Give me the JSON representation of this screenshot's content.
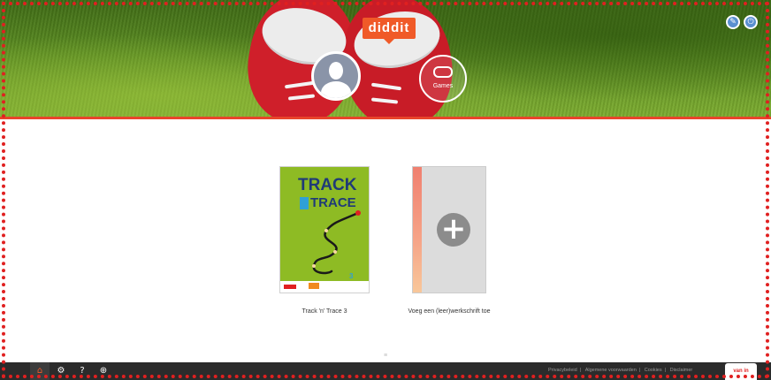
{
  "header": {
    "brand": "diddit",
    "games_label": "Games",
    "edit_icon": "pencil-icon",
    "logout_icon": "power-icon"
  },
  "books": [
    {
      "title_line1": "TRACK",
      "title_line2": "TRACE",
      "title_joiner": "'N'",
      "number": "3",
      "caption": "Track 'n' Trace 3",
      "cover_color": "#8ebb24"
    },
    {
      "caption": "Voeg een (leer)werkschrift toe",
      "icon": "plus-icon"
    }
  ],
  "footer": {
    "buttons": [
      "home-icon",
      "gear-icon",
      "help-icon",
      "add-icon"
    ],
    "links": [
      "Privacybeleid",
      "Algemene voorwaarden",
      "Cookies",
      "Disclaimer"
    ],
    "logo": "van in"
  },
  "colors": {
    "accent": "#f05a28",
    "frame": "#e02020",
    "footer": "#2b2b2b"
  }
}
